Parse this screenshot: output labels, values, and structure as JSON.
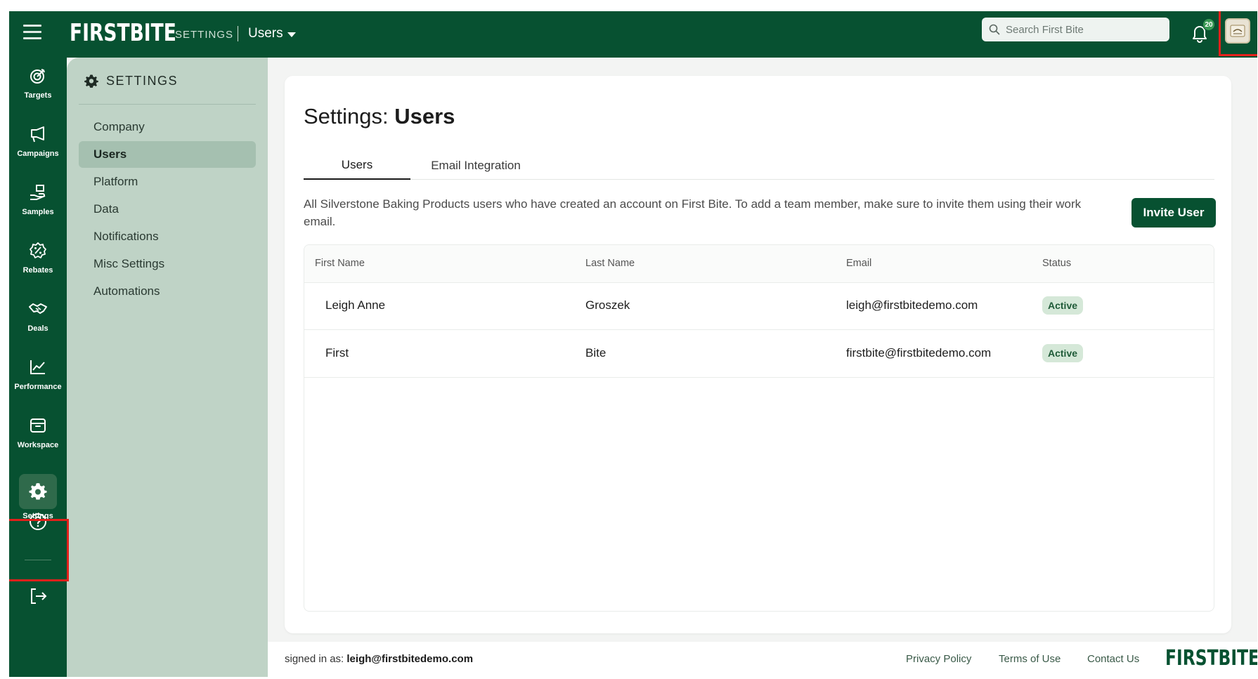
{
  "header": {
    "logo": "FIRSTBITE",
    "breadcrumb_section": "SETTINGS",
    "breadcrumb_current": "Users",
    "search_placeholder": "Search First Bite",
    "notification_count": "20"
  },
  "rail": {
    "items": [
      {
        "label": "Targets",
        "icon": "target-icon"
      },
      {
        "label": "Campaigns",
        "icon": "megaphone-icon"
      },
      {
        "label": "Samples",
        "icon": "hand-box-icon"
      },
      {
        "label": "Rebates",
        "icon": "percent-badge-icon"
      },
      {
        "label": "Deals",
        "icon": "handshake-icon"
      },
      {
        "label": "Performance",
        "icon": "trend-chart-icon"
      },
      {
        "label": "Workspace",
        "icon": "archive-box-icon"
      },
      {
        "label": "Settings",
        "icon": "gear-icon"
      }
    ],
    "help_icon": "question-circle-icon",
    "logout_icon": "logout-icon"
  },
  "subnav": {
    "title": "SETTINGS",
    "items": [
      {
        "label": "Company"
      },
      {
        "label": "Users"
      },
      {
        "label": "Platform"
      },
      {
        "label": "Data"
      },
      {
        "label": "Notifications"
      },
      {
        "label": "Misc Settings"
      },
      {
        "label": "Automations"
      }
    ],
    "active": "Users"
  },
  "main": {
    "title_prefix": "Settings: ",
    "title_bold": "Users",
    "tabs": [
      {
        "label": "Users"
      },
      {
        "label": "Email Integration"
      }
    ],
    "description": "All Silverstone Baking Products users who have created an account on First Bite. To add a team member, make sure to invite them using their work email.",
    "invite_button": "Invite User",
    "table": {
      "columns": [
        "First Name",
        "Last Name",
        "Email",
        "Status"
      ],
      "rows": [
        {
          "first": "Leigh Anne",
          "last": "Groszek",
          "email": "leigh@firstbitedemo.com",
          "status": "Active"
        },
        {
          "first": "First",
          "last": "Bite",
          "email": "firstbite@firstbitedemo.com",
          "status": "Active"
        }
      ]
    }
  },
  "footer": {
    "signed_prefix": "signed in as: ",
    "signed_email": "leigh@firstbitedemo.com",
    "links": [
      "Privacy Policy",
      "Terms of Use",
      "Contact Us"
    ],
    "logo": "FIRSTBITE"
  },
  "colors": {
    "brand_green": "#075131",
    "subnav_bg": "#bfd3c6",
    "active_badge_bg": "#d5e8d8",
    "highlight_red": "#e3201b"
  }
}
